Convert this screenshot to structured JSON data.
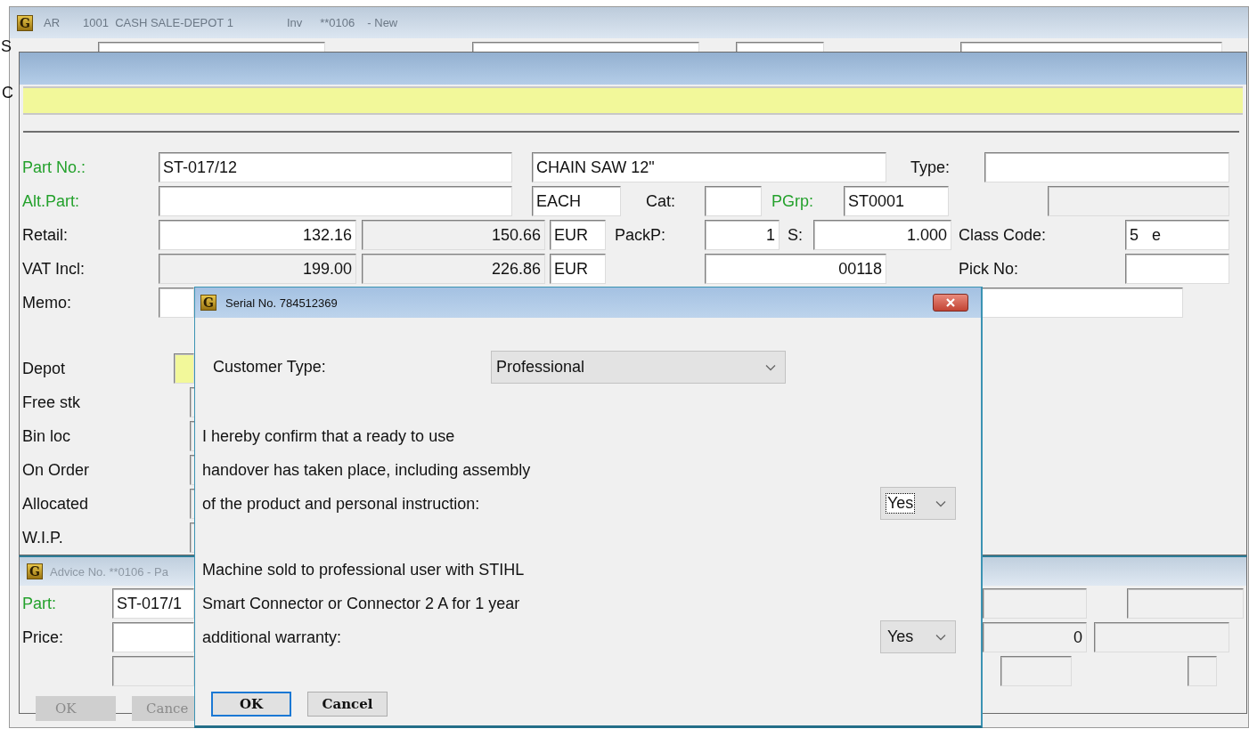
{
  "back_window": {
    "icon_letter": "G",
    "title_parts": [
      "AR",
      "1001  CASH SALE-DEPOT 1",
      "Inv",
      "**0106",
      "- New"
    ],
    "rows": [
      {
        "items": [
          {
            "kind": "label",
            "text": "S"
          },
          {
            "kind": "field"
          },
          {
            "kind": "field"
          },
          {
            "kind": "field"
          },
          {
            "kind": "field"
          }
        ]
      },
      {
        "items": [
          {
            "kind": "label",
            "text": "C"
          }
        ]
      }
    ]
  },
  "part_window": {
    "rows": [
      {
        "items": [
          {
            "kind": "label",
            "text": "Part No.:",
            "lookup": true
          },
          {
            "kind": "field",
            "value": "ST-017/12",
            "disabled": false
          },
          {
            "kind": "field",
            "value": "CHAIN SAW 12\"",
            "disabled": false
          },
          {
            "kind": "label",
            "text": "Type:",
            "lookup": false
          },
          {
            "kind": "field",
            "disabled": false
          }
        ]
      },
      {
        "items": [
          {
            "kind": "label",
            "text": "Alt.Part:",
            "lookup": true
          },
          {
            "kind": "field",
            "disabled": false
          },
          {
            "kind": "field",
            "value": "EACH",
            "disabled": false
          },
          {
            "kind": "label",
            "text": "Cat:",
            "lookup": false
          },
          {
            "kind": "field",
            "disabled": false
          },
          {
            "kind": "label",
            "text": "PGrp:",
            "lookup": true
          },
          {
            "kind": "field",
            "value": "ST0001",
            "disabled": false
          },
          {
            "kind": "field",
            "disabled": true
          }
        ]
      },
      {
        "items": [
          {
            "kind": "label",
            "text": "Retail:",
            "lookup": false
          },
          {
            "kind": "field",
            "value": "132.16",
            "disabled": false
          },
          {
            "kind": "field",
            "value": "150.66",
            "disabled": true
          },
          {
            "kind": "field",
            "value": "EUR",
            "disabled": false
          },
          {
            "kind": "label",
            "text": "PackP:",
            "lookup": false
          },
          {
            "kind": "field",
            "value": "1",
            "disabled": false
          },
          {
            "kind": "label",
            "text": "S:",
            "lookup": false
          },
          {
            "kind": "field",
            "value": "1.000",
            "disabled": false
          },
          {
            "kind": "label",
            "text": "Class Code:",
            "lookup": false
          },
          {
            "kind": "field",
            "value": "5   e",
            "disabled": false
          }
        ]
      },
      {
        "items": [
          {
            "kind": "label",
            "text": "VAT Incl:",
            "lookup": false
          },
          {
            "kind": "field",
            "value": "199.00",
            "disabled": true
          },
          {
            "kind": "field",
            "value": "226.86",
            "disabled": true
          },
          {
            "kind": "field",
            "value": "EUR",
            "disabled": false
          },
          {
            "kind": "field",
            "value": "00118",
            "disabled": false
          },
          {
            "kind": "label",
            "text": "Pick No:",
            "lookup": false
          },
          {
            "kind": "field",
            "disabled": false
          }
        ]
      },
      {
        "items": [
          {
            "kind": "label",
            "text": "Memo:",
            "lookup": false
          },
          {
            "kind": "field",
            "disabled": false
          },
          {
            "kind": "field",
            "disabled": false
          }
        ]
      }
    ],
    "stock": [
      {
        "label": "Depot",
        "highlighted": true
      },
      {
        "label": "Free stk",
        "highlighted": false
      },
      {
        "label": "Bin loc",
        "highlighted": false
      },
      {
        "label": "On Order",
        "highlighted": false
      },
      {
        "label": "Allocated",
        "highlighted": false
      },
      {
        "label": "W.I.P.",
        "highlighted": false
      }
    ]
  },
  "advice_window": {
    "icon_letter": "G",
    "title": "Advice No. **0106 - Pa",
    "rows": [
      {
        "items": [
          {
            "kind": "label",
            "text": "Part:",
            "lookup": true
          },
          {
            "kind": "field",
            "value": "ST-017/1",
            "disabled": false
          },
          {
            "kind": "field",
            "disabled": true
          },
          {
            "kind": "field",
            "disabled": true
          }
        ]
      },
      {
        "items": [
          {
            "kind": "label",
            "text": "Price:",
            "lookup": false
          },
          {
            "kind": "field",
            "disabled": false
          },
          {
            "kind": "field",
            "value": "0",
            "disabled": true
          },
          {
            "kind": "field",
            "disabled": true
          }
        ]
      },
      {
        "items": [
          {
            "kind": "field",
            "disabled": true
          },
          {
            "kind": "field",
            "disabled": true
          },
          {
            "kind": "field",
            "disabled": true
          }
        ]
      }
    ],
    "buttons": [
      {
        "label": "OK",
        "disabled": true
      },
      {
        "label": "Cance",
        "disabled": true
      }
    ]
  },
  "dialog": {
    "icon_letter": "G",
    "title": "Serial No. 784512369",
    "customer_type": {
      "label": "Customer Type:",
      "value": "Professional"
    },
    "questions": [
      {
        "lines": [
          "I hereby confirm that a ready to use",
          "handover has taken place, including assembly",
          "of the product and personal instruction:"
        ],
        "answer": "Yes",
        "focused": true
      },
      {
        "lines": [
          "Machine sold to professional user with STIHL",
          "Smart Connector or Connector 2 A for 1 year",
          "additional warranty:"
        ],
        "answer": "Yes",
        "focused": false
      }
    ],
    "buttons": [
      {
        "label": "OK",
        "default": true
      },
      {
        "label": "Cancel",
        "default": false
      }
    ]
  }
}
